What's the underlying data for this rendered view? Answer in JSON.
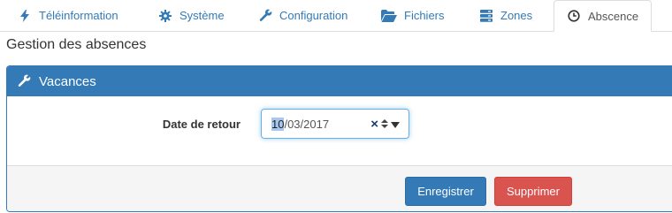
{
  "tabs": [
    {
      "label": "Téléinformation",
      "icon": "lightning-icon"
    },
    {
      "label": "Système",
      "icon": "gear-icon"
    },
    {
      "label": "Configuration",
      "icon": "wrench-icon"
    },
    {
      "label": "Fichiers",
      "icon": "folder-open-icon"
    },
    {
      "label": "Zones",
      "icon": "server-icon"
    },
    {
      "label": "Abscence",
      "icon": "clock-icon",
      "active": true
    }
  ],
  "page": {
    "title": "Gestion des absences"
  },
  "panel": {
    "title": "Vacances",
    "icon": "wrench-icon",
    "date_label": "Date de retour",
    "date_day": "10",
    "date_rest": "/03/2017",
    "save_label": "Enregistrer",
    "delete_label": "Supprimer"
  },
  "colors": {
    "primary": "#337ab7",
    "danger": "#d9534f",
    "footer_bg": "#f5f5f5"
  }
}
